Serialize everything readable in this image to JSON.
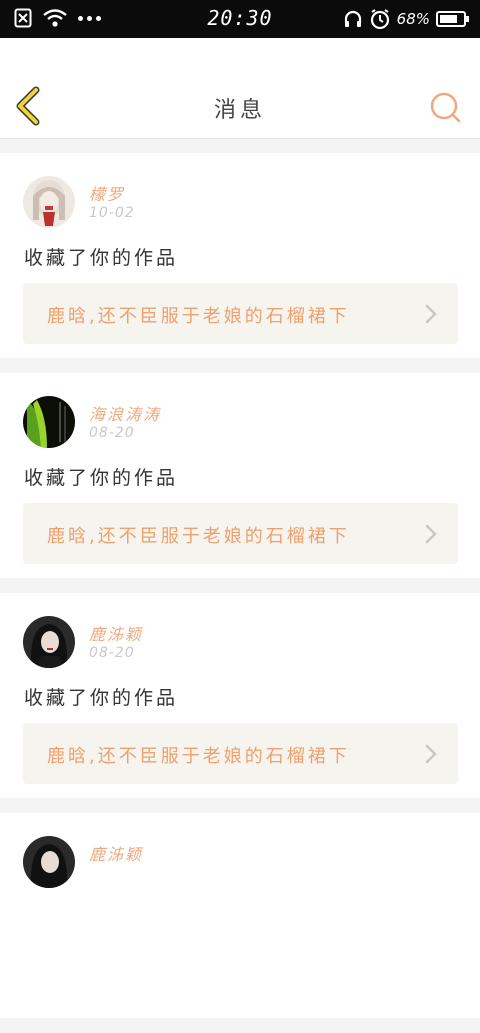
{
  "status_bar": {
    "time": "20:30",
    "battery": "68%"
  },
  "header": {
    "title": "消息"
  },
  "messages": [
    {
      "username": "檬罗",
      "date": "10-02",
      "action": "收藏了你的作品",
      "work_title": "鹿晗,还不臣服于老娘的石榴裙下"
    },
    {
      "username": "海浪涛涛",
      "date": "08-20",
      "action": "收藏了你的作品",
      "work_title": "鹿晗,还不臣服于老娘的石榴裙下"
    },
    {
      "username": "鹿泲颖",
      "date": "08-20",
      "action": "收藏了你的作品",
      "work_title": "鹿晗,还不臣服于老娘的石榴裙下"
    },
    {
      "username": "鹿泲颖",
      "date": "",
      "action": "",
      "work_title": ""
    }
  ],
  "colors": {
    "accent": "#f0a87c",
    "back_icon": "#f2d33a",
    "card_bg": "#ffffff",
    "link_bg": "#f5f4ef"
  }
}
